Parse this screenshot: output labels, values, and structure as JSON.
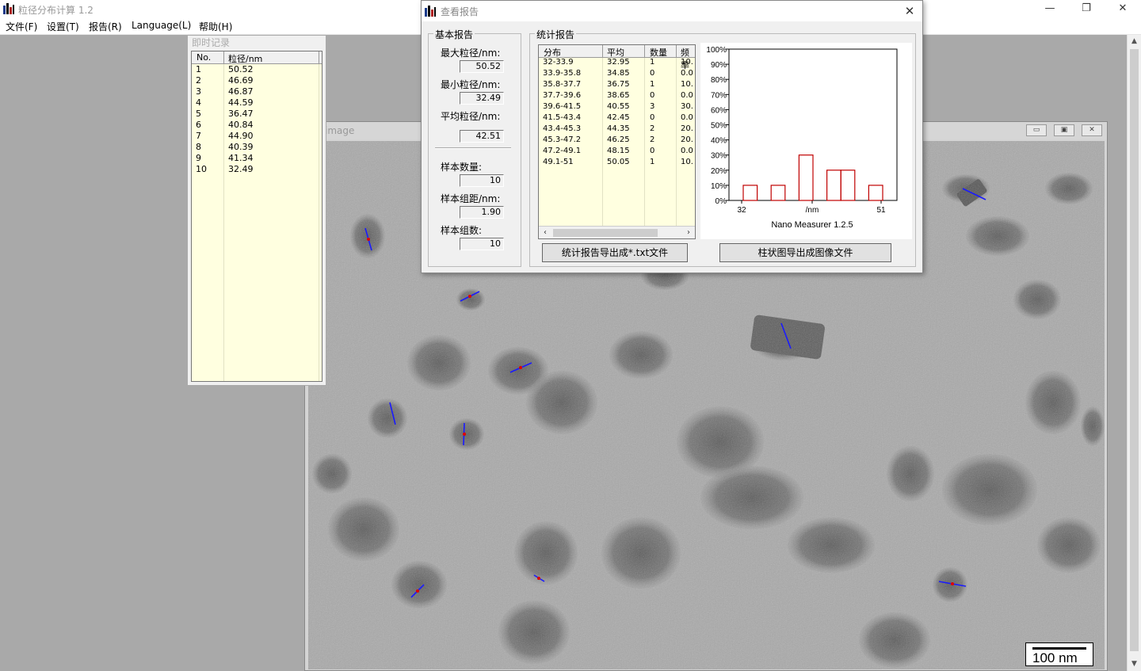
{
  "app": {
    "title": "粒径分布计算 1.2",
    "menu": [
      "文件(F)",
      "设置(T)",
      "报告(R)",
      "Language(L)",
      "帮助(H)"
    ],
    "window_controls": {
      "minimize": "—",
      "restore": "❐",
      "close": "✕"
    }
  },
  "records": {
    "title": "即时记录",
    "headers": [
      "No.",
      "粒径/nm"
    ],
    "rows": [
      [
        "1",
        "50.52"
      ],
      [
        "2",
        "46.69"
      ],
      [
        "3",
        "46.87"
      ],
      [
        "4",
        "44.59"
      ],
      [
        "5",
        "36.47"
      ],
      [
        "6",
        "40.84"
      ],
      [
        "7",
        "44.90"
      ],
      [
        "8",
        "40.39"
      ],
      [
        "9",
        "41.34"
      ],
      [
        "10",
        "32.49"
      ]
    ]
  },
  "image_window": {
    "title": "image",
    "scale_bar_label": "100 nm"
  },
  "report": {
    "title": "查看报告",
    "basic": {
      "label": "基本报告",
      "max_label": "最大粒径/nm:",
      "max_value": "50.52",
      "min_label": "最小粒径/nm:",
      "min_value": "32.49",
      "avg_label": "平均粒径/nm:",
      "avg_value": "42.51",
      "count_label": "样本数量:",
      "count_value": "10",
      "interval_label": "样本组距/nm:",
      "interval_value": "1.90",
      "groups_label": "样本组数:",
      "groups_value": "10"
    },
    "stats": {
      "label": "统计报告",
      "headers": [
        "分布",
        "平均",
        "数量",
        "频率"
      ],
      "rows": [
        [
          "32-33.9",
          "32.95",
          "1",
          "10."
        ],
        [
          "33.9-35.8",
          "34.85",
          "0",
          "0.0"
        ],
        [
          "35.8-37.7",
          "36.75",
          "1",
          "10."
        ],
        [
          "37.7-39.6",
          "38.65",
          "0",
          "0.0"
        ],
        [
          "39.6-41.5",
          "40.55",
          "3",
          "30."
        ],
        [
          "41.5-43.4",
          "42.45",
          "0",
          "0.0"
        ],
        [
          "43.4-45.3",
          "44.35",
          "2",
          "20."
        ],
        [
          "45.3-47.2",
          "46.25",
          "2",
          "20."
        ],
        [
          "47.2-49.1",
          "48.15",
          "0",
          "0.0"
        ],
        [
          "49.1-51",
          "50.05",
          "1",
          "10."
        ]
      ]
    },
    "export_txt_button": "统计报告导出成*.txt文件",
    "export_image_button": "柱状图导出成图像文件"
  },
  "chart_data": {
    "type": "bar",
    "categories": [
      "32-33.9",
      "33.9-35.8",
      "35.8-37.7",
      "37.7-39.6",
      "39.6-41.5",
      "41.5-43.4",
      "43.4-45.3",
      "45.3-47.2",
      "47.2-49.1",
      "49.1-51"
    ],
    "values": [
      10,
      0,
      10,
      0,
      30,
      0,
      20,
      20,
      0,
      10
    ],
    "y_ticks": [
      "100%",
      "90%",
      "80%",
      "70%",
      "60%",
      "50%",
      "40%",
      "30%",
      "20%",
      "10%",
      "0%"
    ],
    "x_tick_labels": [
      "32",
      "/nm",
      "51"
    ],
    "ylim": [
      0,
      100
    ],
    "caption": "Nano Measurer 1.2.5",
    "bar_color": "#c00000"
  }
}
